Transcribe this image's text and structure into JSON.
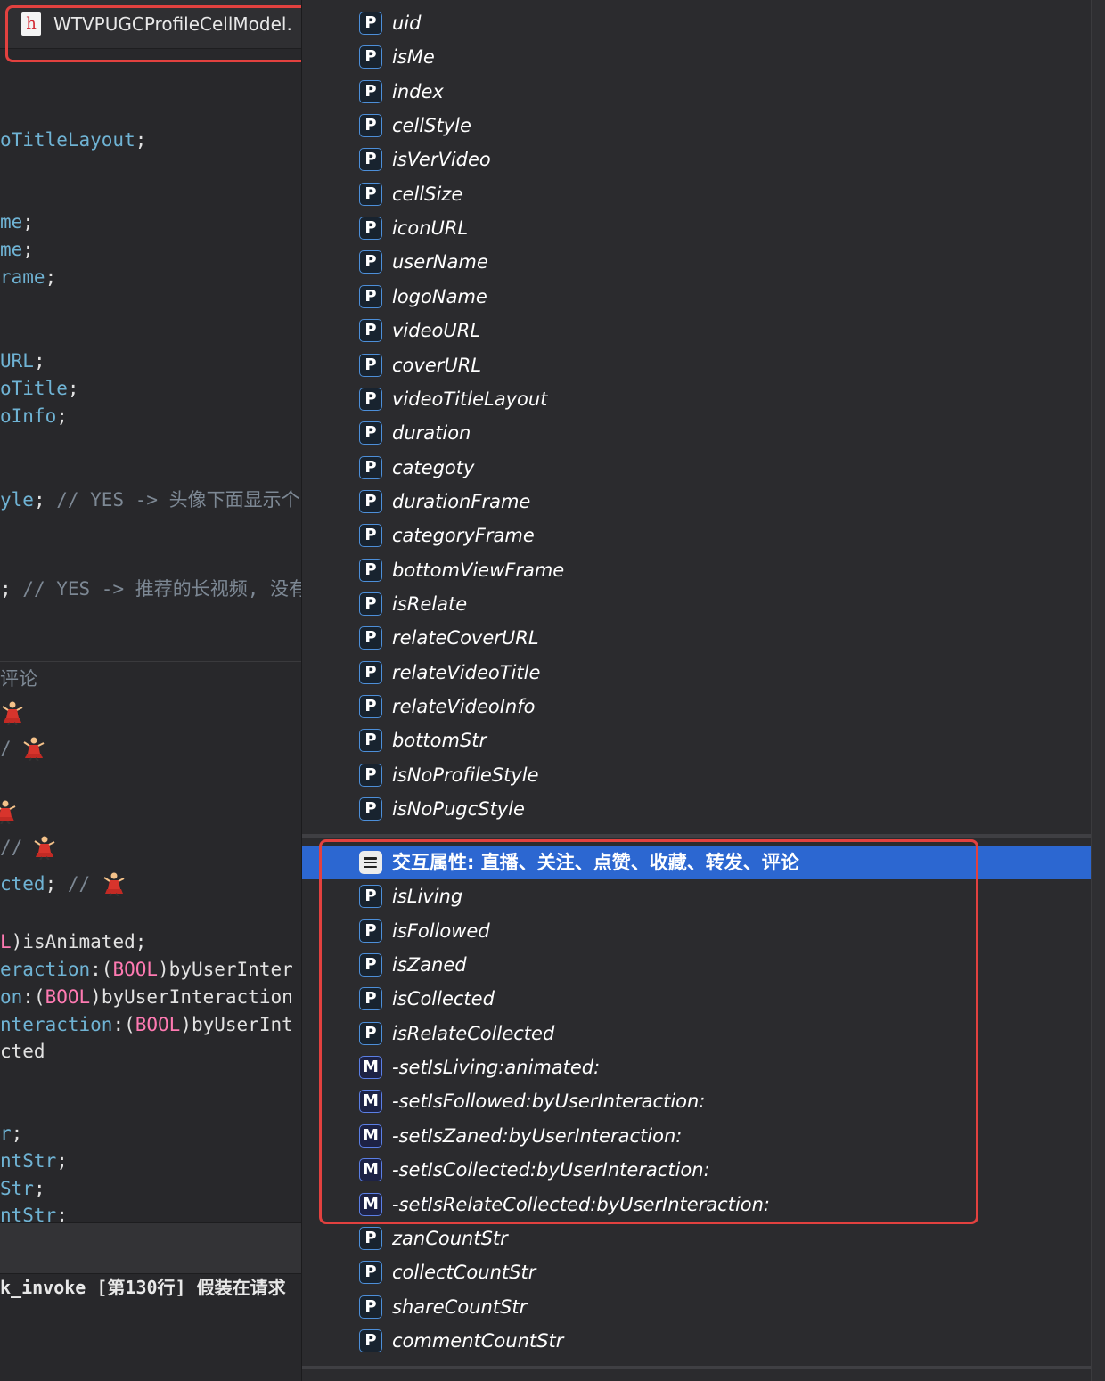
{
  "editor": {
    "file_name": "WTVPUGCProfileCellModel.",
    "file_icon_letter": "h",
    "code_lines": [
      {
        "segs": [
          {
            "t": "oTitleLayout",
            "c": "ident"
          },
          {
            "t": ";",
            "c": "plain"
          }
        ]
      },
      {
        "segs": [
          {
            "t": "me",
            "c": "ident"
          },
          {
            "t": ";",
            "c": "plain"
          }
        ]
      },
      {
        "segs": [
          {
            "t": "me",
            "c": "ident"
          },
          {
            "t": ";",
            "c": "plain"
          }
        ]
      },
      {
        "segs": [
          {
            "t": "rame",
            "c": "ident"
          },
          {
            "t": ";",
            "c": "plain"
          }
        ]
      },
      {
        "segs": [
          {
            "t": "URL",
            "c": "ident"
          },
          {
            "t": ";",
            "c": "plain"
          }
        ]
      },
      {
        "segs": [
          {
            "t": "oTitle",
            "c": "ident"
          },
          {
            "t": ";",
            "c": "plain"
          }
        ]
      },
      {
        "segs": [
          {
            "t": "oInfo",
            "c": "ident"
          },
          {
            "t": ";",
            "c": "plain"
          }
        ]
      },
      {
        "segs": [
          {
            "t": "yle",
            "c": "ident"
          },
          {
            "t": "; ",
            "c": "plain"
          },
          {
            "t": "// YES -> 头像下面显示个",
            "c": "comment"
          }
        ]
      },
      {
        "segs": [
          {
            "t": "; ",
            "c": "plain"
          },
          {
            "t": "// YES -> 推荐的长视频, 没有",
            "c": "comment"
          }
        ]
      },
      {
        "segs": [
          {
            "t": "评论",
            "c": "comment"
          }
        ]
      },
      {
        "segs": [
          {
            "t": "/",
            "c": "comment"
          }
        ]
      },
      {
        "segs": [
          {
            "t": "//",
            "c": "comment"
          }
        ]
      },
      {
        "segs": [
          {
            "t": "cted",
            "c": "ident"
          },
          {
            "t": "; ",
            "c": "plain"
          },
          {
            "t": "//",
            "c": "comment"
          }
        ]
      },
      {
        "segs": [
          {
            "t": "L",
            "c": "kw"
          },
          {
            "t": ")isAnimated;",
            "c": "plain"
          }
        ]
      },
      {
        "segs": [
          {
            "t": "eraction",
            "c": "ident"
          },
          {
            "t": ":(",
            "c": "plain"
          },
          {
            "t": "BOOL",
            "c": "kw"
          },
          {
            "t": ")byUserInter",
            "c": "plain"
          }
        ]
      },
      {
        "segs": [
          {
            "t": "on",
            "c": "ident"
          },
          {
            "t": ":(",
            "c": "plain"
          },
          {
            "t": "BOOL",
            "c": "kw"
          },
          {
            "t": ")byUserInteraction",
            "c": "plain"
          }
        ]
      },
      {
        "segs": [
          {
            "t": "nteraction",
            "c": "ident"
          },
          {
            "t": ":(",
            "c": "plain"
          },
          {
            "t": "BOOL",
            "c": "kw"
          },
          {
            "t": ")byUserInt",
            "c": "plain"
          }
        ]
      },
      {
        "segs": [
          {
            "t": "cted",
            "c": "plain"
          }
        ]
      },
      {
        "segs": [
          {
            "t": "r",
            "c": "ident"
          },
          {
            "t": ";",
            "c": "plain"
          }
        ]
      },
      {
        "segs": [
          {
            "t": "ntStr",
            "c": "ident"
          },
          {
            "t": ";",
            "c": "plain"
          }
        ]
      },
      {
        "segs": [
          {
            "t": "Str",
            "c": "ident"
          },
          {
            "t": ";",
            "c": "plain"
          }
        ]
      },
      {
        "segs": [
          {
            "t": "ntStr",
            "c": "ident"
          },
          {
            "t": ";",
            "c": "plain"
          }
        ]
      }
    ],
    "console_text": "k_invoke [第130行] 假装在请求"
  },
  "symbols": [
    {
      "kind": "P",
      "name": "uid"
    },
    {
      "kind": "P",
      "name": "isMe"
    },
    {
      "kind": "P",
      "name": "index"
    },
    {
      "kind": "P",
      "name": "cellStyle"
    },
    {
      "kind": "P",
      "name": "isVerVideo"
    },
    {
      "kind": "P",
      "name": "cellSize"
    },
    {
      "kind": "P",
      "name": "iconURL"
    },
    {
      "kind": "P",
      "name": "userName"
    },
    {
      "kind": "P",
      "name": "logoName"
    },
    {
      "kind": "P",
      "name": "videoURL"
    },
    {
      "kind": "P",
      "name": "coverURL"
    },
    {
      "kind": "P",
      "name": "videoTitleLayout"
    },
    {
      "kind": "P",
      "name": "duration"
    },
    {
      "kind": "P",
      "name": "categoty"
    },
    {
      "kind": "P",
      "name": "durationFrame"
    },
    {
      "kind": "P",
      "name": "categoryFrame"
    },
    {
      "kind": "P",
      "name": "bottomViewFrame"
    },
    {
      "kind": "P",
      "name": "isRelate"
    },
    {
      "kind": "P",
      "name": "relateCoverURL"
    },
    {
      "kind": "P",
      "name": "relateVideoTitle"
    },
    {
      "kind": "P",
      "name": "relateVideoInfo"
    },
    {
      "kind": "P",
      "name": "bottomStr"
    },
    {
      "kind": "P",
      "name": "isNoProfileStyle"
    },
    {
      "kind": "P",
      "name": "isNoPugcStyle"
    },
    {
      "kind": "MARK",
      "name": "交互属性: 直播、关注、点赞、收藏、转发、评论",
      "selected": true
    },
    {
      "kind": "P",
      "name": "isLiving"
    },
    {
      "kind": "P",
      "name": "isFollowed"
    },
    {
      "kind": "P",
      "name": "isZaned"
    },
    {
      "kind": "P",
      "name": "isCollected"
    },
    {
      "kind": "P",
      "name": "isRelateCollected"
    },
    {
      "kind": "M",
      "name": "-setIsLiving:animated:"
    },
    {
      "kind": "M",
      "name": "-setIsFollowed:byUserInteraction:"
    },
    {
      "kind": "M",
      "name": "-setIsZaned:byUserInteraction:"
    },
    {
      "kind": "M",
      "name": "-setIsCollected:byUserInteraction:"
    },
    {
      "kind": "M",
      "name": "-setIsRelateCollected:byUserInteraction:"
    },
    {
      "kind": "P",
      "name": "zanCountStr"
    },
    {
      "kind": "P",
      "name": "collectCountStr"
    },
    {
      "kind": "P",
      "name": "shareCountStr"
    },
    {
      "kind": "P",
      "name": "commentCountStr"
    }
  ],
  "colors": {
    "selection": "#2c67d1",
    "highlight_box": "#e2413f",
    "property_badge": "#4d8fd9",
    "method_badge": "#5b7fe6",
    "keyword": "#ff7ab2",
    "identifier": "#6fb3d4"
  }
}
